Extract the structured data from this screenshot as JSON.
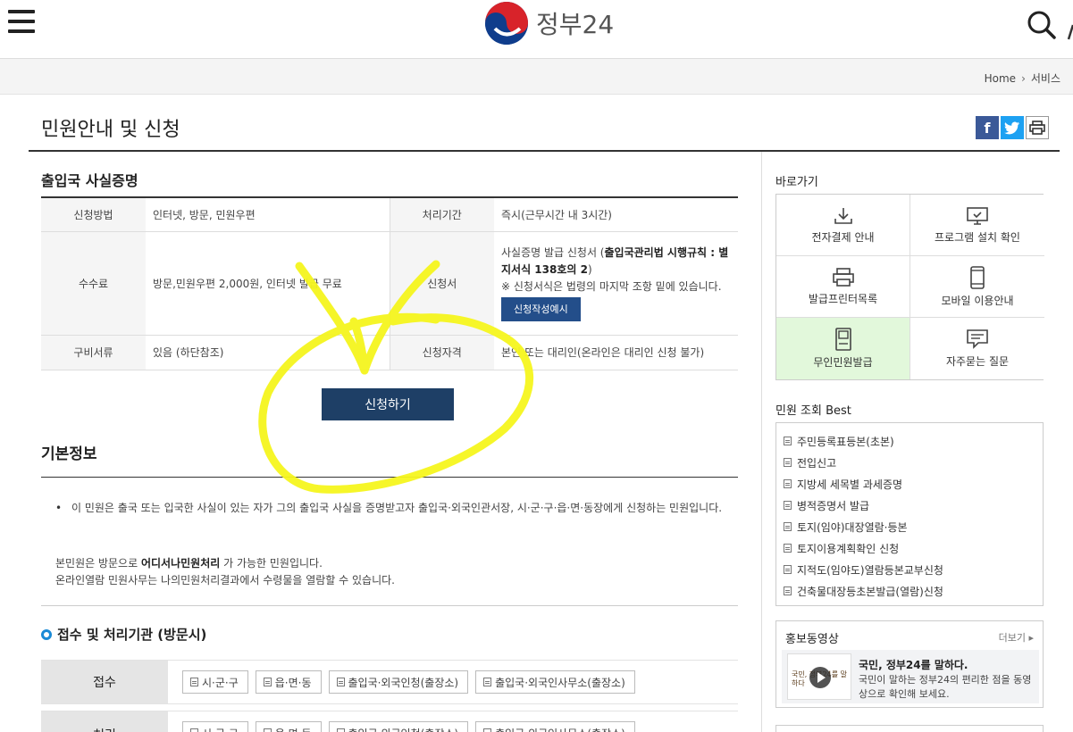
{
  "header": {
    "logo_text": "정부24",
    "menu_icon": "hamburger-menu-icon",
    "search_icon": "search-icon"
  },
  "breadcrumb": {
    "home": "Home",
    "current": "서비스"
  },
  "page": {
    "title": "민원안내 및 신청"
  },
  "service": {
    "title": "출입국 사실증명",
    "rows": {
      "method_label": "신청방법",
      "method_value": "인터넷, 방문, 민원우편",
      "period_label": "처리기간",
      "period_value": "즉시(근무시간 내 3시간)",
      "fee_label": "수수료",
      "fee_value": "방문,민원우편 2,000원, 인터넷 발급 무료",
      "form_label": "신청서",
      "form_value_1": "사실증명 발급 신청서 (",
      "form_value_bold": "출입국관리법 시행규칙 : 별지서식 138호의 2",
      "form_value_2": ")",
      "form_note": "※ 신청서식은 법령의 마지막 조항 밑에 있습니다.",
      "form_sample_button": "신청작성예시",
      "docs_label": "구비서류",
      "docs_value": "있음 (하단참조)",
      "qual_label": "신청자격",
      "qual_value": "본인 또는 대리인(온라인은 대리인 신청 불가)"
    },
    "apply_button": "신청하기"
  },
  "basic": {
    "title": "기본정보",
    "bullet": "이 민원은 출국 또는 입국한 사실이 있는 자가 그의 출입국 사실을 증명받고자 출입국·외국인관서장, 시·군·구·읍·면·동장에게 신청하는 민원입니다.",
    "para1_a": "본민원은 방문으로 ",
    "para1_bold": "어디서나민원처리",
    "para1_b": " 가 가능한 민원입니다.",
    "para2": "온라인열람 민원사무는 나의민원처리결과에서 수령물을 열람할 수 있습니다."
  },
  "org": {
    "title": "접수 및 처리기관 (방문시)",
    "reception_label": "접수",
    "processing_label": "처리",
    "chips": [
      "시·군·구",
      "읍·면·동",
      "출입국·외국인청(출장소)",
      "출입국·외국인사무소(출장소)"
    ]
  },
  "sidebar": {
    "quick_title": "바로가기",
    "quick_items": [
      {
        "label": "전자결제 안내",
        "icon": "download-icon"
      },
      {
        "label": "프로그램 설치 확인",
        "icon": "monitor-check-icon"
      },
      {
        "label": "발급프린터목록",
        "icon": "printer-icon"
      },
      {
        "label": "모바일 이용안내",
        "icon": "mobile-icon"
      },
      {
        "label": "무인민원발급",
        "icon": "kiosk-icon"
      },
      {
        "label": "자주묻는 질문",
        "icon": "speech-bubble-icon"
      }
    ],
    "best_title": "민원 조회 Best",
    "best_items": [
      "주민등록표등본(초본)",
      "전입신고",
      "지방세 세목별 과세증명",
      "병적증명서 발급",
      "토지(임야)대장열람·등본",
      "토지이용계획확인 신청",
      "지적도(임야도)열람등본교부신청",
      "건축물대장등초본발급(열람)신청"
    ],
    "video_title": "홍보동영상",
    "video_more": "더보기 ▸",
    "video_headline": "국민, 정부24를 말하다.",
    "video_desc": "국민이 말하는 정부24의 편리한 점을 동영상으로 확인해 보세요.",
    "video_thumb_text": "국민, 정부24를 말하다"
  },
  "colors": {
    "apply_button": "#1e3f66",
    "sample_button": "#234e8a",
    "highlight_cell": "#e2f8db",
    "scribble": "#f5f51e"
  }
}
